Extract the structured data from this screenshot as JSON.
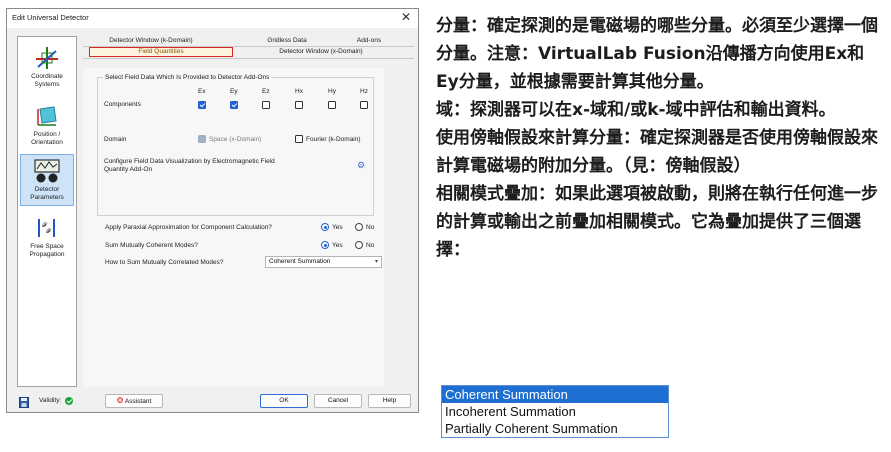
{
  "dialog": {
    "title": "Edit Universal Detector",
    "close_label": "✕",
    "nav": [
      {
        "label_lines": [
          "Coordinate",
          "Systems"
        ],
        "icon": "coordinate-systems-icon"
      },
      {
        "label_lines": [
          "Position /",
          "Orientation"
        ],
        "icon": "position-orientation-icon"
      },
      {
        "label_lines": [
          "Detector",
          "Parameters"
        ],
        "icon": "detector-parameters-icon"
      },
      {
        "label_lines": [
          "Free Space",
          "Propagation"
        ],
        "icon": "free-space-propagation-icon"
      }
    ],
    "tabs_row1": [
      "Detector Window (k-Domain)",
      "Gridless Data",
      "Add-ons"
    ],
    "tabs_row2": [
      "Field Quantities",
      "Detector Window (x-Domain)"
    ],
    "group_title": "Select Field Data Which Is Provided to Detector Add-Ons",
    "components_label": "Components",
    "components": [
      {
        "name": "Ex",
        "checked": true
      },
      {
        "name": "Ey",
        "checked": true
      },
      {
        "name": "Ez",
        "checked": false
      },
      {
        "name": "Hx",
        "checked": false
      },
      {
        "name": "Hy",
        "checked": false
      },
      {
        "name": "Hz",
        "checked": false
      }
    ],
    "domain_label": "Domain",
    "domain_space": "Space (x-Domain)",
    "domain_fourier": "Fourier (k-Domain)",
    "configure_line1": "Configure Field Data Visualization by Electromagnetic Field",
    "configure_line2": "Quantity Add-On",
    "paraxial_label": "Apply Paraxial Approximation for Component Calculation?",
    "sum_coherent_label": "Sum Mutually Coherent Modes?",
    "sum_correlated_label": "How to Sum Mutually Correlated Modes?",
    "yes": "Yes",
    "no": "No",
    "paraxial_value": "Yes",
    "sum_coherent_value": "Yes",
    "correlated_select_value": "Coherent Summation",
    "validity_label": "Validity:",
    "assistant_label": "Assistant",
    "ok_label": "OK",
    "cancel_label": "Cancel",
    "help_label": "Help"
  },
  "description": [
    "分量：確定探測的是電磁場的哪些分量。必須至少選擇一個分量。注意：VirtualLab Fusion沿傳播方向使用Ex和Ey分量，並根據需要計算其他分量。",
    "域：探測器可以在x-域和/或k-域中評估和輸出資料。",
    "使用傍軸假設來計算分量：確定探測器是否使用傍軸假設來計算電磁場的附加分量。（見：傍軸假設）",
    "相關模式疊加：如果此選項被啟動，則將在執行任何進一步的計算或輸出之前疊加相關模式。它為疊加提供了三個選擇："
  ],
  "dropdown_options": [
    "Coherent Summation",
    "Incoherent Summation",
    "Partially Coherent Summation"
  ],
  "colors": {
    "accent": "#1f6fd2",
    "tab_highlight": "#d42a2a",
    "valid": "#1aa33a"
  }
}
